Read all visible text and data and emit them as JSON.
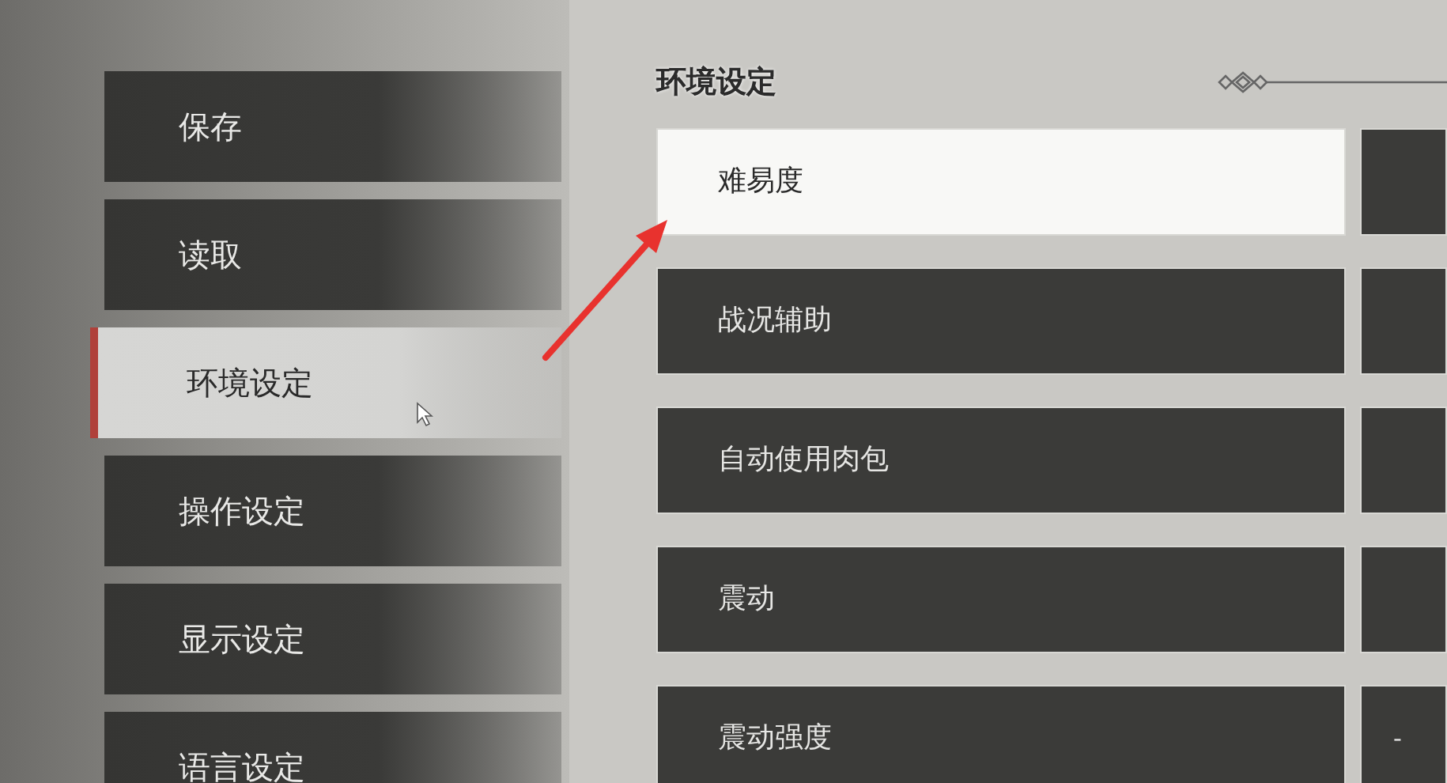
{
  "menu": [
    {
      "label": "保存",
      "selected": false
    },
    {
      "label": "读取",
      "selected": false
    },
    {
      "label": "环境设定",
      "selected": true
    },
    {
      "label": "操作设定",
      "selected": false
    },
    {
      "label": "显示设定",
      "selected": false
    },
    {
      "label": "语言设定",
      "selected": false
    }
  ],
  "section_title": "环境设定",
  "settings": [
    {
      "label": "难易度",
      "selected": true
    },
    {
      "label": "战况辅助",
      "selected": false
    },
    {
      "label": "自动使用肉包",
      "selected": false
    },
    {
      "label": "震动",
      "selected": false
    },
    {
      "label": "震动强度",
      "selected": false,
      "value": "-"
    }
  ]
}
